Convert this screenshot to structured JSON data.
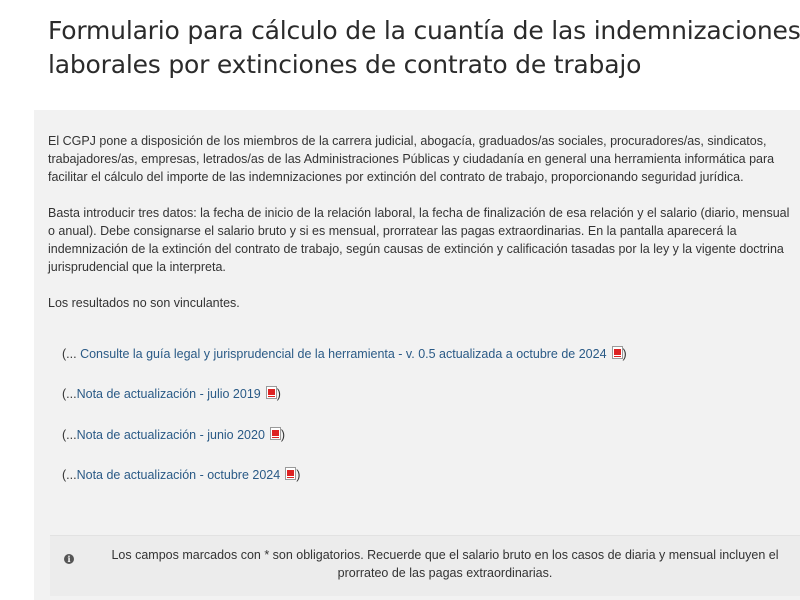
{
  "header": {
    "title_line1": "Formulario para cálculo de la cuantía de las indemnizaciones",
    "title_line2": "laborales por extinciones de contrato de trabajo"
  },
  "intro": {
    "p1_line1": "El CGPJ pone a disposición de los miembros de la carrera judicial, abogacía, graduados/as sociales, procuradores/as, sindicatos,",
    "p1_line2": "trabajadores/as, empresas, letrados/as de las Administraciones Públicas y ciudadanía en general una herramienta informática para",
    "p1_line3": "facilitar el cálculo del importe de las indemnizaciones por extinción del contrato de trabajo, proporcionando seguridad jurídica.",
    "p2_line1": "Basta  introducir  tres datos: la fecha de inicio de la relación laboral, la fecha de finalización de esa relación y el salario (diario, mensual",
    "p2_line2": "o anual). Debe consignarse el salario bruto y si es mensual, prorratear las pagas extraordinarias. En la pantalla aparecerá la",
    "p2_line3": "indemnización de la extinción del contrato de trabajo, según causas de extinción y calificación tasadas por la ley y la vigente doctrina",
    "p2_line4": "jurisprudencial que la interpreta.",
    "p3": "Los resultados no son vinculantes."
  },
  "links": [
    {
      "open": "(... ",
      "label": "Consulte la guía legal y jurisprudencial de la herramienta - v. 0.5 actualizada a octubre de 2024",
      "close": ")",
      "icon": "pdf-icon"
    },
    {
      "open": "(...",
      "label": "Nota de actualización - julio 2019",
      "close": ")",
      "icon": "pdf-icon"
    },
    {
      "open": "(...",
      "label": "Nota de actualización - junio 2020",
      "close": ")",
      "icon": "pdf-icon"
    },
    {
      "open": "(...",
      "label": "Nota de actualización - octubre 2024",
      "close": ")",
      "icon": "pdf-icon"
    }
  ],
  "notice": {
    "icon": "info-icon",
    "icon_glyph": "i",
    "line1": "Los campos marcados con * son obligatorios. Recuerde que el salario bruto en los casos de diaria y mensual incluyen el",
    "line2": "prorrateo de las pagas extraordinarias."
  }
}
